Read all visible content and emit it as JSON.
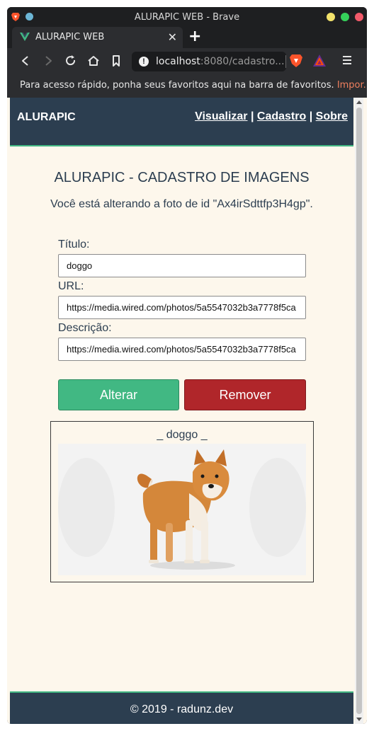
{
  "window": {
    "title": "ALURAPIC WEB - Brave"
  },
  "tab": {
    "title": "ALURAPIC WEB",
    "close": "✕",
    "new_tab": "+"
  },
  "toolbar": {
    "url_host": "localhost",
    "url_rest": ":8080/cadastro..."
  },
  "bookmarks_bar": {
    "message": "Para acesso rápido, ponha seus favoritos aqui na barra de favoritos.",
    "import_link": "Impor..."
  },
  "header": {
    "brand": "ALURAPIC",
    "nav": [
      {
        "label": "Visualizar"
      },
      {
        "label": "Cadastro"
      },
      {
        "label": "Sobre"
      }
    ],
    "separator": "|"
  },
  "main": {
    "title": "ALURAPIC - CADASTRO DE IMAGENS",
    "subtitle": "Você está alterando a foto de id \"Ax4irSdttfp3H4gp\".",
    "form": {
      "titulo_label": "Título:",
      "titulo_value": "doggo",
      "url_label": "URL:",
      "url_value": "https://media.wired.com/photos/5a5547032b3a7778f5ca",
      "descricao_label": "Descrição:",
      "descricao_value": "https://media.wired.com/photos/5a5547032b3a7778f5ca",
      "alter_button": "Alterar",
      "remove_button": "Remover"
    },
    "preview": {
      "title": "_ doggo _",
      "image": "shiba-inu-dog-photo"
    }
  },
  "footer": {
    "text": "© 2019 - radunz.dev"
  },
  "colors": {
    "header_bg": "#2c3e50",
    "accent_green": "#41b883",
    "remove_red": "#b0262a",
    "page_bg": "#fdf7ec"
  }
}
